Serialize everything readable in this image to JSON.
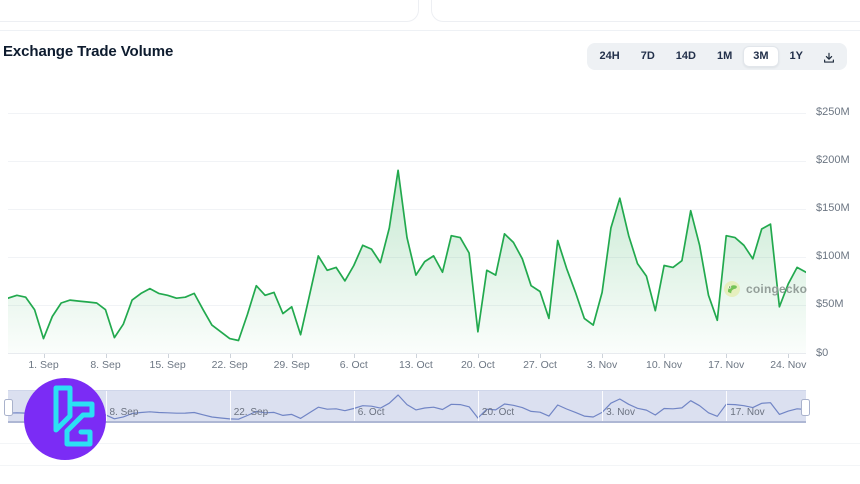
{
  "header": {
    "title": "Exchange Trade Volume"
  },
  "range_selector": {
    "options": [
      "24H",
      "7D",
      "14D",
      "1M",
      "3M",
      "1Y"
    ],
    "selected": "3M"
  },
  "watermark": {
    "text": "coingecko"
  },
  "chart_data": {
    "type": "area",
    "title": "Exchange Trade Volume",
    "y_unit": "USD",
    "ylim": [
      0,
      250
    ],
    "grid": "horizontal",
    "legend": "none",
    "y_tick_labels": [
      "$250M",
      "$200M",
      "$150M",
      "$100M",
      "$50M",
      "$0"
    ],
    "y_tick_values": [
      250,
      200,
      150,
      100,
      50,
      0
    ],
    "x": [
      "28. Aug",
      "29. Aug",
      "30. Aug",
      "31. Aug",
      "1. Sep",
      "2. Sep",
      "3. Sep",
      "4. Sep",
      "5. Sep",
      "6. Sep",
      "7. Sep",
      "8. Sep",
      "9. Sep",
      "10. Sep",
      "11. Sep",
      "12. Sep",
      "13. Sep",
      "14. Sep",
      "15. Sep",
      "16. Sep",
      "17. Sep",
      "18. Sep",
      "19. Sep",
      "20. Sep",
      "21. Sep",
      "22. Sep",
      "23. Sep",
      "24. Sep",
      "25. Sep",
      "26. Sep",
      "27. Sep",
      "28. Sep",
      "29. Sep",
      "30. Sep",
      "1. Oct",
      "2. Oct",
      "3. Oct",
      "4. Oct",
      "5. Oct",
      "6. Oct",
      "7. Oct",
      "8. Oct",
      "9. Oct",
      "10. Oct",
      "11. Oct",
      "12. Oct",
      "13. Oct",
      "14. Oct",
      "15. Oct",
      "16. Oct",
      "17. Oct",
      "18. Oct",
      "19. Oct",
      "20. Oct",
      "21. Oct",
      "22. Oct",
      "23. Oct",
      "24. Oct",
      "25. Oct",
      "26. Oct",
      "27. Oct",
      "28. Oct",
      "29. Oct",
      "30. Oct",
      "31. Oct",
      "1. Nov",
      "2. Nov",
      "3. Nov",
      "4. Nov",
      "5. Nov",
      "6. Nov",
      "7. Nov",
      "8. Nov",
      "9. Nov",
      "10. Nov",
      "11. Nov",
      "12. Nov",
      "13. Nov",
      "14. Nov",
      "15. Nov",
      "16. Nov",
      "17. Nov",
      "18. Nov",
      "19. Nov",
      "20. Nov",
      "21. Nov",
      "22. Nov",
      "23. Nov",
      "24. Nov",
      "25. Nov",
      "26. Nov"
    ],
    "values_musd": [
      57,
      60,
      58,
      45,
      15,
      38,
      52,
      55,
      54,
      53,
      52,
      45,
      16,
      30,
      55,
      62,
      67,
      62,
      60,
      57,
      58,
      62,
      45,
      29,
      22,
      15,
      13,
      40,
      70,
      60,
      63,
      41,
      48,
      19,
      60,
      101,
      86,
      89,
      75,
      91,
      112,
      108,
      94,
      130,
      190,
      120,
      81,
      95,
      101,
      84,
      122,
      120,
      104,
      22,
      86,
      81,
      124,
      115,
      98,
      70,
      64,
      36,
      117,
      88,
      63,
      36,
      29,
      63,
      130,
      161,
      122,
      93,
      80,
      44,
      91,
      89,
      96,
      148,
      112,
      60,
      34,
      122,
      120,
      112,
      98,
      129,
      134,
      48,
      72,
      89,
      84
    ],
    "x_ticks": [
      {
        "i": 4,
        "label": "1. Sep"
      },
      {
        "i": 11,
        "label": "8. Sep"
      },
      {
        "i": 18,
        "label": "15. Sep"
      },
      {
        "i": 25,
        "label": "22. Sep"
      },
      {
        "i": 32,
        "label": "29. Sep"
      },
      {
        "i": 39,
        "label": "6. Oct"
      },
      {
        "i": 46,
        "label": "13. Oct"
      },
      {
        "i": 53,
        "label": "20. Oct"
      },
      {
        "i": 60,
        "label": "27. Oct"
      },
      {
        "i": 67,
        "label": "3. Nov"
      },
      {
        "i": 74,
        "label": "10. Nov"
      },
      {
        "i": 81,
        "label": "17. Nov"
      },
      {
        "i": 88,
        "label": "24. Nov"
      }
    ],
    "navigator_ticks": [
      {
        "i": 11,
        "label": "8. Sep"
      },
      {
        "i": 25,
        "label": "22. Sep"
      },
      {
        "i": 39,
        "label": "6. Oct"
      },
      {
        "i": 53,
        "label": "20. Oct"
      },
      {
        "i": 67,
        "label": "3. Nov"
      },
      {
        "i": 81,
        "label": "17. Nov"
      }
    ],
    "colors": {
      "line": "#22a94e",
      "fill_top": "rgba(34,169,78,0.26)",
      "fill_bottom": "rgba(34,169,78,0.02)",
      "navigator_line": "#7185c5",
      "navigator_bg": "#dbe0f0"
    }
  }
}
